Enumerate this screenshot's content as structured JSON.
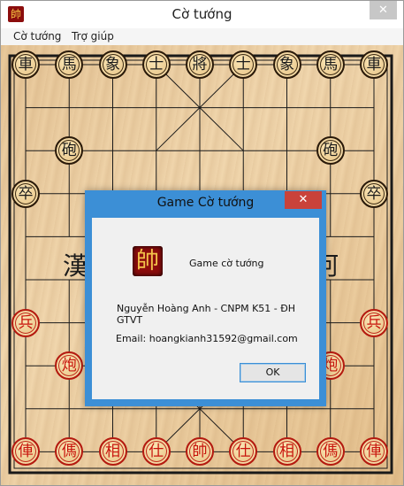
{
  "window": {
    "title": "Cờ tướng",
    "close": "✕",
    "app_icon_glyph": "帥"
  },
  "menu": {
    "items": [
      "Cờ tướng",
      "Trợ giúp"
    ]
  },
  "board": {
    "river_left": "漢",
    "river_right": "河",
    "black_pieces": [
      {
        "label": "車",
        "file": 0,
        "rank": 0
      },
      {
        "label": "馬",
        "file": 1,
        "rank": 0
      },
      {
        "label": "象",
        "file": 2,
        "rank": 0
      },
      {
        "label": "士",
        "file": 3,
        "rank": 0
      },
      {
        "label": "將",
        "file": 4,
        "rank": 0
      },
      {
        "label": "士",
        "file": 5,
        "rank": 0
      },
      {
        "label": "象",
        "file": 6,
        "rank": 0
      },
      {
        "label": "馬",
        "file": 7,
        "rank": 0
      },
      {
        "label": "車",
        "file": 8,
        "rank": 0
      },
      {
        "label": "砲",
        "file": 1,
        "rank": 2
      },
      {
        "label": "砲",
        "file": 7,
        "rank": 2
      },
      {
        "label": "卒",
        "file": 0,
        "rank": 3
      },
      {
        "label": "卒",
        "file": 8,
        "rank": 3
      }
    ],
    "red_pieces": [
      {
        "label": "兵",
        "file": 0,
        "rank": 6
      },
      {
        "label": "兵",
        "file": 8,
        "rank": 6
      },
      {
        "label": "炮",
        "file": 1,
        "rank": 7
      },
      {
        "label": "炮",
        "file": 7,
        "rank": 7
      },
      {
        "label": "俥",
        "file": 0,
        "rank": 9
      },
      {
        "label": "傌",
        "file": 1,
        "rank": 9
      },
      {
        "label": "相",
        "file": 2,
        "rank": 9
      },
      {
        "label": "仕",
        "file": 3,
        "rank": 9
      },
      {
        "label": "帥",
        "file": 4,
        "rank": 9
      },
      {
        "label": "仕",
        "file": 5,
        "rank": 9
      },
      {
        "label": "相",
        "file": 6,
        "rank": 9
      },
      {
        "label": "傌",
        "file": 7,
        "rank": 9
      },
      {
        "label": "俥",
        "file": 8,
        "rank": 9
      }
    ]
  },
  "dialog": {
    "title": "Game Cờ tướng",
    "close": "✕",
    "logo_glyph": "帥",
    "game_name": "Game cờ tướng",
    "author": "Nguyễn Hoàng Anh - CNPM K51 - ĐH GTVT",
    "email": "Email: hoangkianh31592@gmail.com",
    "ok_label": "OK"
  }
}
